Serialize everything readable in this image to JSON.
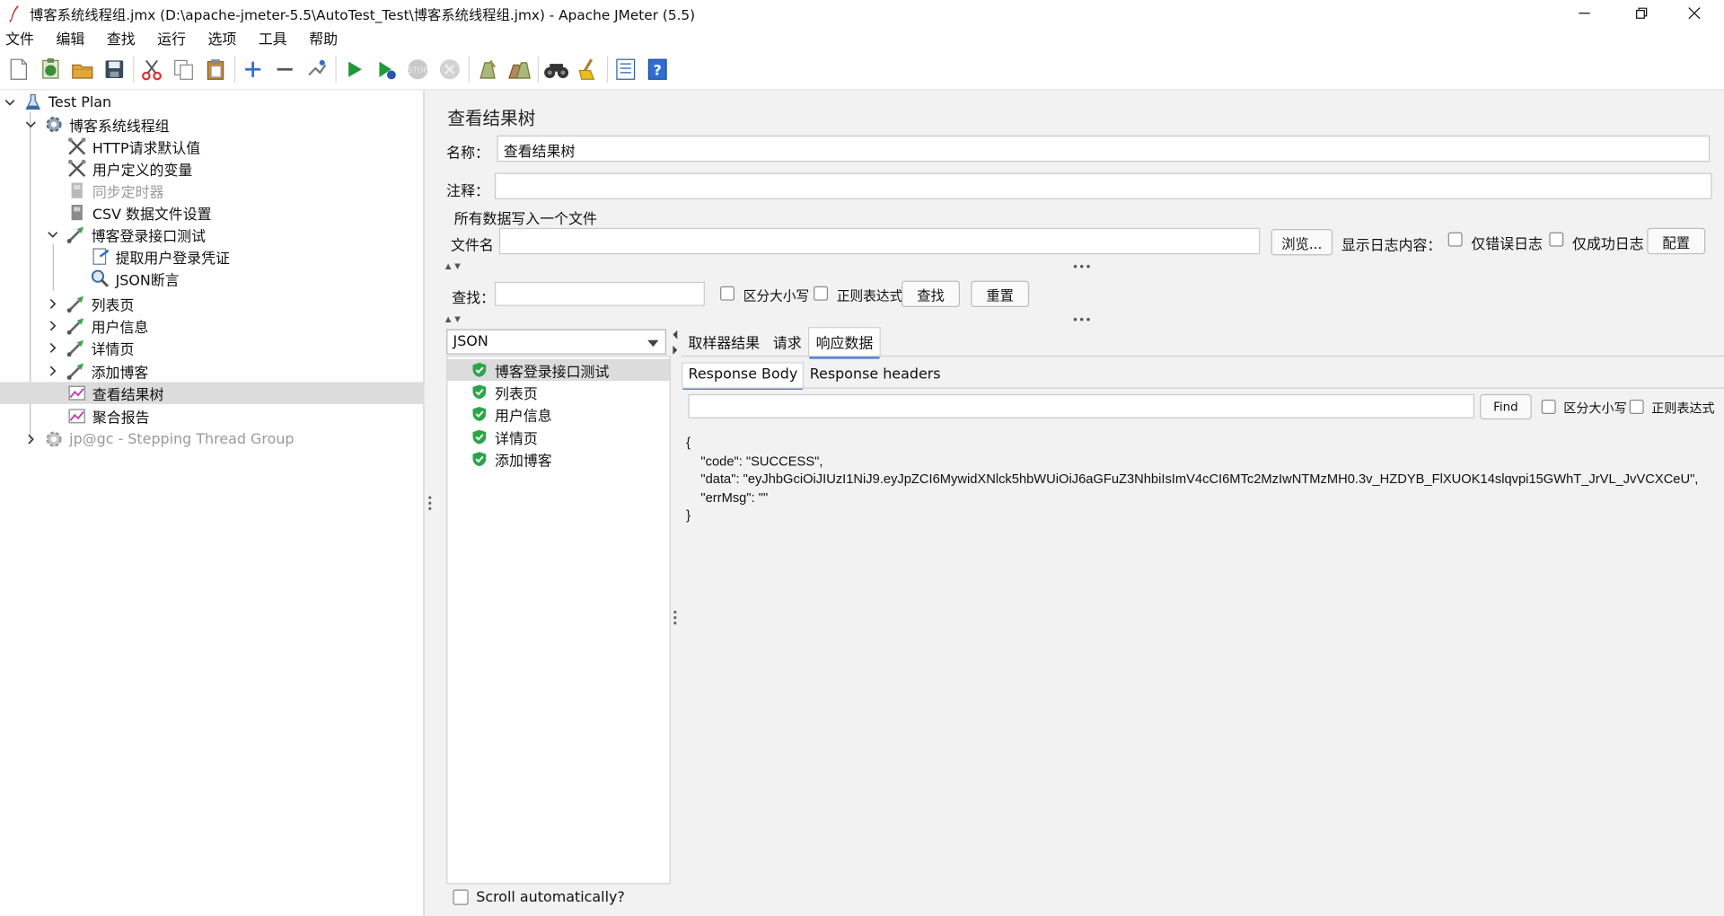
{
  "window": {
    "title": "博客系统线程组.jmx (D:\\apache-jmeter-5.5\\AutoTest_Test\\博客系统线程组.jmx) - Apache JMeter (5.5)",
    "minimize_icon": "minimize-icon",
    "maximize_icon": "restore-icon",
    "close_icon": "close-icon"
  },
  "menu": {
    "items": [
      "文件",
      "编辑",
      "查找",
      "运行",
      "选项",
      "工具",
      "帮助"
    ]
  },
  "toolbar": {
    "icons": [
      "new-icon",
      "templates-icon",
      "open-icon",
      "save-icon",
      "cut-icon",
      "copy-icon",
      "paste-icon",
      "expand-icon",
      "collapse-icon",
      "toggle-icon",
      "start-icon",
      "start-no-pause-icon",
      "stop-icon",
      "shutdown-icon",
      "clear-icon",
      "clear-all-icon",
      "search-icon",
      "reset-search-icon",
      "function-helper-icon",
      "help-icon"
    ]
  },
  "tree": {
    "items": [
      {
        "label": "Test Plan",
        "icon": "test-plan-icon",
        "state": "expanded"
      },
      {
        "label": "博客系统线程组",
        "icon": "thread-group-icon",
        "state": "expanded"
      },
      {
        "label": "HTTP请求默认值",
        "icon": "config-element-icon"
      },
      {
        "label": "用户定义的变量",
        "icon": "config-element-icon"
      },
      {
        "label": "同步定时器",
        "icon": "timer-icon",
        "disabled": true
      },
      {
        "label": "CSV 数据文件设置",
        "icon": "csv-icon"
      },
      {
        "label": "博客登录接口测试",
        "icon": "sampler-icon",
        "state": "expanded"
      },
      {
        "label": "提取用户登录凭证",
        "icon": "extractor-icon"
      },
      {
        "label": "JSON断言",
        "icon": "assertion-icon"
      },
      {
        "label": "列表页",
        "icon": "sampler-icon",
        "state": "collapsed"
      },
      {
        "label": "用户信息",
        "icon": "sampler-icon",
        "state": "collapsed"
      },
      {
        "label": "详情页",
        "icon": "sampler-icon",
        "state": "collapsed"
      },
      {
        "label": "添加博客",
        "icon": "sampler-icon",
        "state": "collapsed"
      },
      {
        "label": "查看结果树",
        "icon": "listener-icon",
        "selected": true
      },
      {
        "label": "聚合报告",
        "icon": "listener-icon"
      },
      {
        "label": "jp@gc - Stepping Thread Group",
        "icon": "thread-group-icon",
        "state": "collapsed",
        "disabled": true
      }
    ]
  },
  "panel": {
    "heading": "查看结果树",
    "name_label": "名称：",
    "name_value": "查看结果树",
    "comment_label": "注释：",
    "comment_value": "",
    "file_section": "所有数据写入一个文件",
    "filename_label": "文件名",
    "filename_value": "",
    "browse_button": "浏览...",
    "log_display_label": "显示日志内容：",
    "errors_only": "仅错误日志",
    "success_only": "仅成功日志",
    "configure_button": "配置",
    "search_label": "查找：",
    "search_value": "",
    "case_sensitive": "区分大小写",
    "regex": "正则表达式",
    "find_button": "查找",
    "reset_button": "重置",
    "renderer": "JSON",
    "scroll_auto": "Scroll automatically?"
  },
  "results": {
    "items": [
      {
        "label": "博客登录接口测试",
        "status": "success",
        "selected": true
      },
      {
        "label": "列表页",
        "status": "success"
      },
      {
        "label": "用户信息",
        "status": "success"
      },
      {
        "label": "详情页",
        "status": "success"
      },
      {
        "label": "添加博客",
        "status": "success"
      }
    ]
  },
  "detail": {
    "tabs": [
      "取样器结果",
      "请求",
      "响应数据"
    ],
    "active_tab": "响应数据",
    "subtabs": [
      "Response Body",
      "Response headers"
    ],
    "active_subtab": "Response Body",
    "find_value": "",
    "find_button": "Find",
    "case_sensitive": "区分大小写",
    "regex": "正则表达式",
    "body": "{\n    \"code\": \"SUCCESS\",\n    \"data\": \"eyJhbGciOiJIUzI1NiJ9.eyJpZCI6MywidXNlck5hbWUiOiJ6aGFuZ3NhbiIsImV4cCI6MTc2MzIwNTMzMH0.3v_HZDYB_FlXUOK14slqvpi15GWhT_JrVL_JvVCXCeU\",\n    \"errMsg\": \"\"\n}"
  }
}
